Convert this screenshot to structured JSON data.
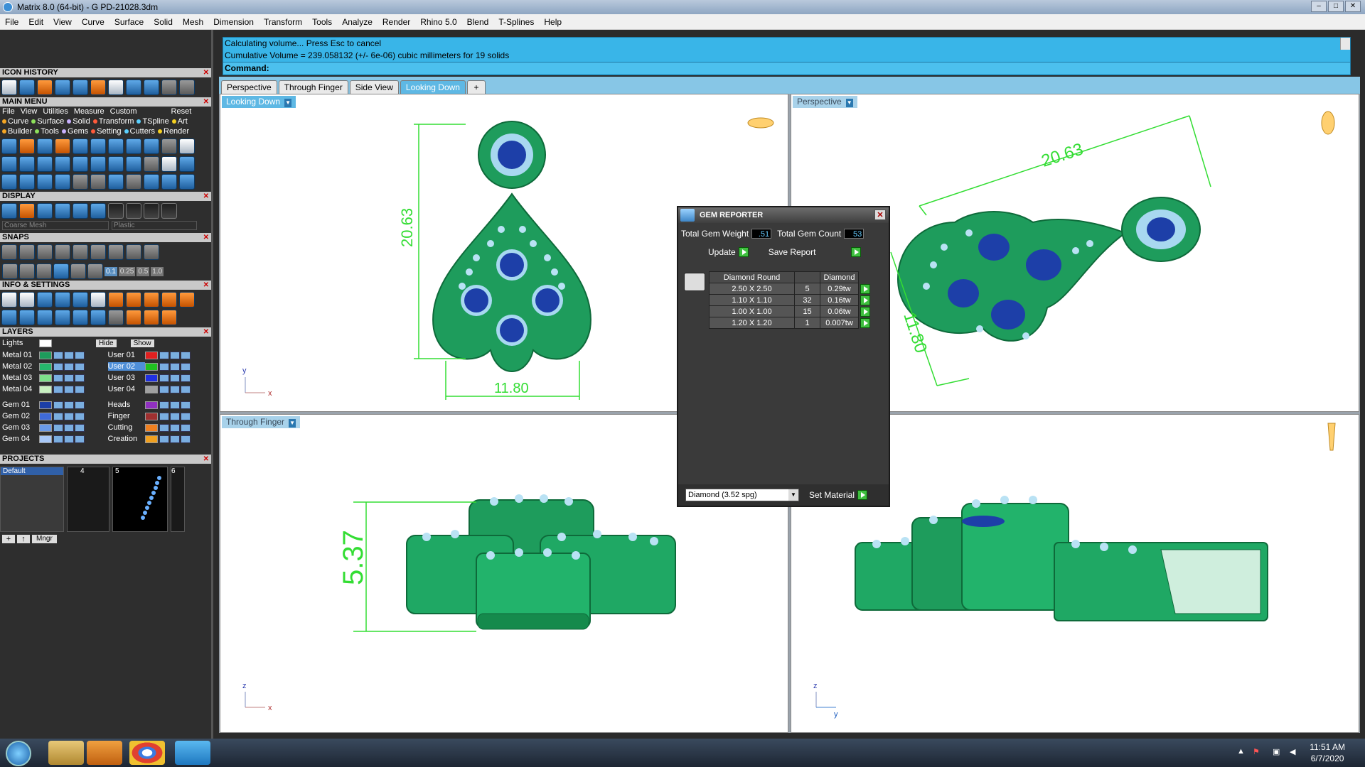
{
  "window": {
    "title": "Matrix 8.0 (64-bit) - G PD-21028.3dm",
    "controls": [
      "–",
      "□",
      "✕"
    ]
  },
  "menubar": [
    "File",
    "Edit",
    "View",
    "Curve",
    "Surface",
    "Solid",
    "Mesh",
    "Dimension",
    "Transform",
    "Tools",
    "Analyze",
    "Render",
    "Rhino 5.0",
    "Blend",
    "T-Splines",
    "Help"
  ],
  "command": {
    "line1": "Calculating volume... Press Esc to cancel",
    "line2": "Cumulative Volume = 239.058132 (+/- 6e-06) cubic millimeters for 19 solids",
    "prompt": "Command:"
  },
  "viewtabs": [
    "Perspective",
    "Through Finger",
    "Side View",
    "Looking Down",
    "+"
  ],
  "left": {
    "icon_history": "ICON HISTORY",
    "main_menu": "MAIN MENU",
    "main_menu_items": [
      "File",
      "View",
      "Utilities",
      "Measure",
      "Custom",
      "Reset"
    ],
    "main_menu_row2": [
      "Curve",
      "Surface",
      "Solid",
      "Transform",
      "TSpline",
      "Art"
    ],
    "main_menu_row3": [
      "Builder",
      "Tools",
      "Gems",
      "Setting",
      "Cutters",
      "Render"
    ],
    "display": "DISPLAY",
    "display_mesh": "Coarse Mesh",
    "display_material": "Plastic",
    "snaps": "SNAPS",
    "snap_values": [
      "0.1",
      "0.25",
      "0.5",
      "1.0"
    ],
    "info": "INFO & SETTINGS",
    "layers": "LAYERS",
    "lights": "Lights",
    "hide": "Hide",
    "show": "Show",
    "layer_left": [
      "Metal 01",
      "Metal 02",
      "Metal 03",
      "Metal 04",
      "Gem 01",
      "Gem 02",
      "Gem 03",
      "Gem 04"
    ],
    "layer_right": [
      "User 01",
      "User 02",
      "User 03",
      "User 04",
      "Heads",
      "Finger",
      "Cutting",
      "Creation"
    ],
    "projects": "PROJECTS",
    "project_default": "Default",
    "project_nums": [
      "4",
      "5",
      "6"
    ],
    "mngr": "Mngr"
  },
  "viewports": {
    "tl": {
      "name": "Looking Down",
      "dim_v": "20.63",
      "dim_h": "11.80",
      "axis1": "y",
      "axis2": "x"
    },
    "tr": {
      "name": "Perspective",
      "dim_a": "20.63",
      "dim_b": "11.80"
    },
    "bl": {
      "name": "Through Finger",
      "dim": "5.37",
      "axis1": "z",
      "axis2": "x"
    },
    "br": {
      "axis1": "z",
      "axis2": "y"
    }
  },
  "gem_reporter": {
    "title": "GEM REPORTER",
    "weight_label": "Total Gem Weight",
    "weight": ".51",
    "count_label": "Total Gem Count",
    "count": "53",
    "update": "Update",
    "save": "Save Report",
    "col1": "Diamond Round",
    "col3": "Diamond",
    "rows": [
      {
        "size": "2.50 X 2.50",
        "qty": "5",
        "wt": "0.29tw"
      },
      {
        "size": "1.10 X 1.10",
        "qty": "32",
        "wt": "0.16tw"
      },
      {
        "size": "1.00 X 1.00",
        "qty": "15",
        "wt": "0.06tw"
      },
      {
        "size": "1.20 X 1.20",
        "qty": "1",
        "wt": "0.007tw"
      }
    ],
    "material": "Diamond    (3.52 spg)",
    "set_material": "Set Material"
  },
  "taskbar": {
    "time": "11:51 AM",
    "date": "6/7/2020"
  }
}
